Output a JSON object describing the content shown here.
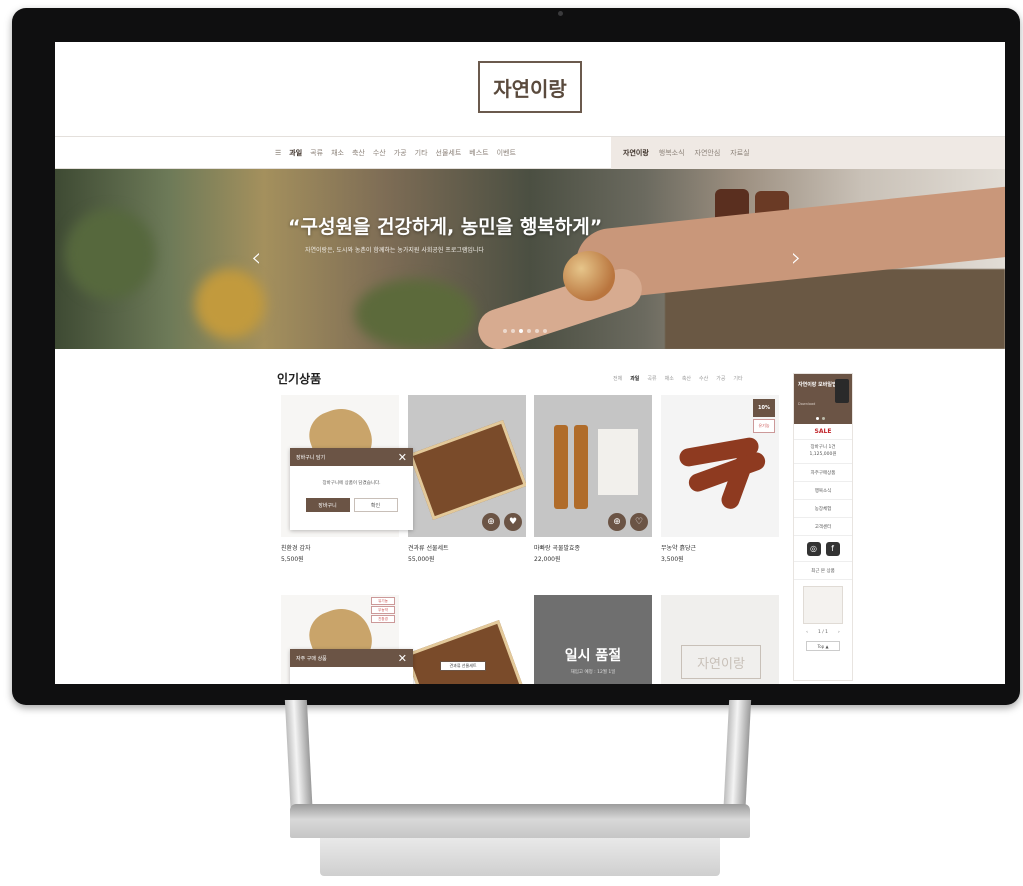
{
  "brand": {
    "logo": "자연이랑"
  },
  "gnb": {
    "left_items": [
      "과일",
      "곡류",
      "채소",
      "축산",
      "수산",
      "가공",
      "기타",
      "선물세트",
      "베스트",
      "이벤트"
    ],
    "left_active_index": 0,
    "right_items": [
      "자연이랑",
      "행복소식",
      "자연안심",
      "자료실"
    ],
    "right_active_index": 0
  },
  "hero": {
    "headline": "“구성원을 건강하게, 농민을 행복하게”",
    "sub": "자연이랑은, 도시와 농촌이 함께하는 농가지원 사회공헌 프로그램입니다",
    "prev": "‹",
    "next": "›"
  },
  "popular": {
    "title": "인기상품",
    "tabs": [
      "전체",
      "과일",
      "곡류",
      "채소",
      "축산",
      "수산",
      "가공",
      "기타"
    ],
    "active_tab": 1,
    "products": [
      {
        "name": "친환경 감자",
        "price": "5,500원"
      },
      {
        "name": "견과류 선물세트",
        "price": "55,000원"
      },
      {
        "name": "마빠랑 곡물발효종",
        "price": "22,000원"
      },
      {
        "name": "무농약 흙당근",
        "price": "3,500원",
        "badge": "10%",
        "badge2": "유기농"
      }
    ]
  },
  "cart_popup": {
    "title": "장바구니 담기",
    "close": "✕",
    "message": "장바구니에 상품이 담겼습니다.",
    "go_cart": "장바구니",
    "confirm": "확인"
  },
  "row2": {
    "badges": [
      "유기농",
      "무농약",
      "친환경"
    ],
    "label": "견과류 선물세트",
    "soldout": "일시 품절",
    "soldout_sub": "재입고 예정 : 12월 1일",
    "placeholder_logo": "자연이랑"
  },
  "review_popup": {
    "title": "자주 구매 상품",
    "close": "✕"
  },
  "side": {
    "banner_title": "자연이랑 모바일앱",
    "banner_sub": "Download",
    "sale": "SALE",
    "cart_label": "장바구니 1건",
    "cart_total": "1,125,000원",
    "items": [
      "자주구매상품",
      "행복소식",
      "농장체험",
      "고객센터"
    ],
    "sns": [
      "◎",
      "f"
    ],
    "recent_label": "최근 본 상품",
    "pager_prev": "‹",
    "pager_text": "1 / 1",
    "pager_next": "›",
    "top": "Top ▲"
  },
  "colors": {
    "accent": "#6b5445",
    "sale": "#c1272d",
    "gnb_right_bg": "#efe9e4"
  }
}
